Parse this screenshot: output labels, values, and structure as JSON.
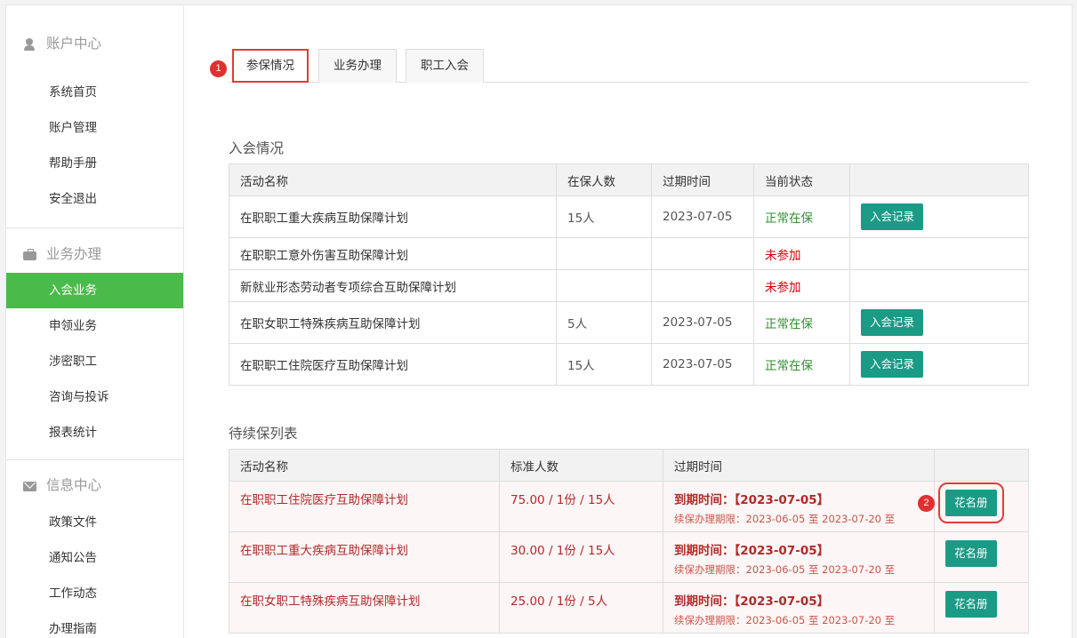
{
  "sidebar": {
    "sections": [
      {
        "title": "账户中心",
        "items": [
          "系统首页",
          "账户管理",
          "帮助手册",
          "安全退出"
        ]
      },
      {
        "title": "业务办理",
        "items": [
          "入会业务",
          "申领业务",
          "涉密职工",
          "咨询与投诉",
          "报表统计"
        ]
      },
      {
        "title": "信息中心",
        "items": [
          "政策文件",
          "通知公告",
          "工作动态",
          "办理指南"
        ]
      }
    ]
  },
  "tabs": [
    "参保情况",
    "业务办理",
    "职工入会"
  ],
  "badges": {
    "tab": "1",
    "button": "2"
  },
  "join_section": {
    "title": "入会情况",
    "headers": [
      "活动名称",
      "在保人数",
      "过期时间",
      "当前状态",
      ""
    ],
    "rows": [
      {
        "name": "在职职工重大疾病互助保障计划",
        "count": "15人",
        "date": "2023-07-05",
        "status": "正常在保",
        "action": "入会记录"
      },
      {
        "name": "在职职工意外伤害互助保障计划",
        "count": "",
        "date": "",
        "status": "未参加",
        "action": ""
      },
      {
        "name": "新就业形态劳动者专项综合互助保障计划",
        "count": "",
        "date": "",
        "status": "未参加",
        "action": ""
      },
      {
        "name": "在职女职工特殊疾病互助保障计划",
        "count": "5人",
        "date": "2023-07-05",
        "status": "正常在保",
        "action": "入会记录"
      },
      {
        "name": "在职职工住院医疗互助保障计划",
        "count": "15人",
        "date": "2023-07-05",
        "status": "正常在保",
        "action": "入会记录"
      }
    ]
  },
  "renew_section": {
    "title": "待续保列表",
    "headers": [
      "活动名称",
      "标准人数",
      "过期时间",
      ""
    ],
    "rows": [
      {
        "name": "在职职工住院医疗互助保障计划",
        "std": "75.00 / 1份 / 15人",
        "expire": "到期时间：【2023-07-05】",
        "period": "续保办理期限：2023-06-05 至 2023-07-20 至",
        "action": "花名册"
      },
      {
        "name": "在职职工重大疾病互助保障计划",
        "std": "30.00 / 1份 / 15人",
        "expire": "到期时间：【2023-07-05】",
        "period": "续保办理期限：2023-06-05 至 2023-07-20 至",
        "action": "花名册"
      },
      {
        "name": "在职女职工特殊疾病互助保障计划",
        "std": "25.00 / 1份 / 5人",
        "expire": "到期时间：【2023-07-05】",
        "period": "续保办理期限：2023-06-05 至 2023-07-20 至",
        "action": "花名册"
      }
    ]
  }
}
